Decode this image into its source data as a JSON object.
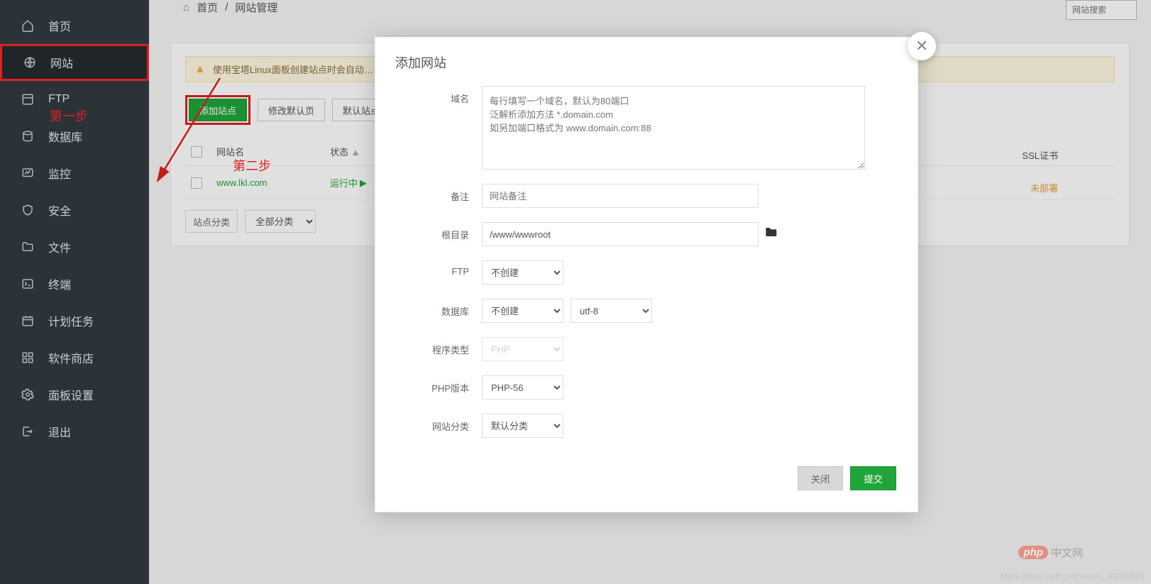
{
  "sidebar": {
    "items": [
      {
        "label": "首页",
        "icon": "home"
      },
      {
        "label": "网站",
        "icon": "globe",
        "active": true
      },
      {
        "label": "FTP",
        "icon": "ftp"
      },
      {
        "label": "数据库",
        "icon": "database"
      },
      {
        "label": "监控",
        "icon": "monitor"
      },
      {
        "label": "安全",
        "icon": "shield"
      },
      {
        "label": "文件",
        "icon": "folder"
      },
      {
        "label": "终端",
        "icon": "terminal"
      },
      {
        "label": "计划任务",
        "icon": "calendar"
      },
      {
        "label": "软件商店",
        "icon": "apps"
      },
      {
        "label": "面板设置",
        "icon": "gear"
      },
      {
        "label": "退出",
        "icon": "logout"
      }
    ]
  },
  "breadcrumb": {
    "home": "首页",
    "sep": "/",
    "current": "网站管理"
  },
  "search": {
    "placeholder": "网站搜索"
  },
  "panel": {
    "warning": "使用宝塔Linux面板创建站点时会自动…",
    "buttons": {
      "add": "添加站点",
      "modify": "修改默认页",
      "default": "默认站点"
    },
    "columns": {
      "name": "网站名",
      "status": "状态",
      "ssl": "SSL证书"
    },
    "rows": [
      {
        "name": "www.lkl.com",
        "status": "运行中",
        "ssl": "未部署"
      }
    ],
    "filter": {
      "label": "站点分类",
      "value": "全部分类"
    }
  },
  "annotations": {
    "step1": "第一步",
    "step2": "第二步"
  },
  "modal": {
    "title": "添加网站",
    "labels": {
      "domain": "域名",
      "remark": "备注",
      "root": "根目录",
      "ftp": "FTP",
      "database": "数据库",
      "progType": "程序类型",
      "phpVersion": "PHP版本",
      "siteCategory": "网站分类"
    },
    "domain_placeholder": "每行填写一个域名，默认为80端口\n泛解析添加方法 *.domain.com\n如另加端口格式为 www.domain.com:88",
    "remark_placeholder": "网站备注",
    "root_value": "/www/wwwroot",
    "ftp_value": "不创建",
    "database_value": "不创建",
    "charset_value": "utf-8",
    "progType_value": "PHP",
    "phpVersion_value": "PHP-56",
    "siteCategory_value": "默认分类",
    "buttons": {
      "close": "关闭",
      "submit": "提交"
    }
  },
  "watermark": {
    "php": "php",
    "php_text": "中文网",
    "csdn": "https://blog.csdn.net/weixin_49392641"
  }
}
